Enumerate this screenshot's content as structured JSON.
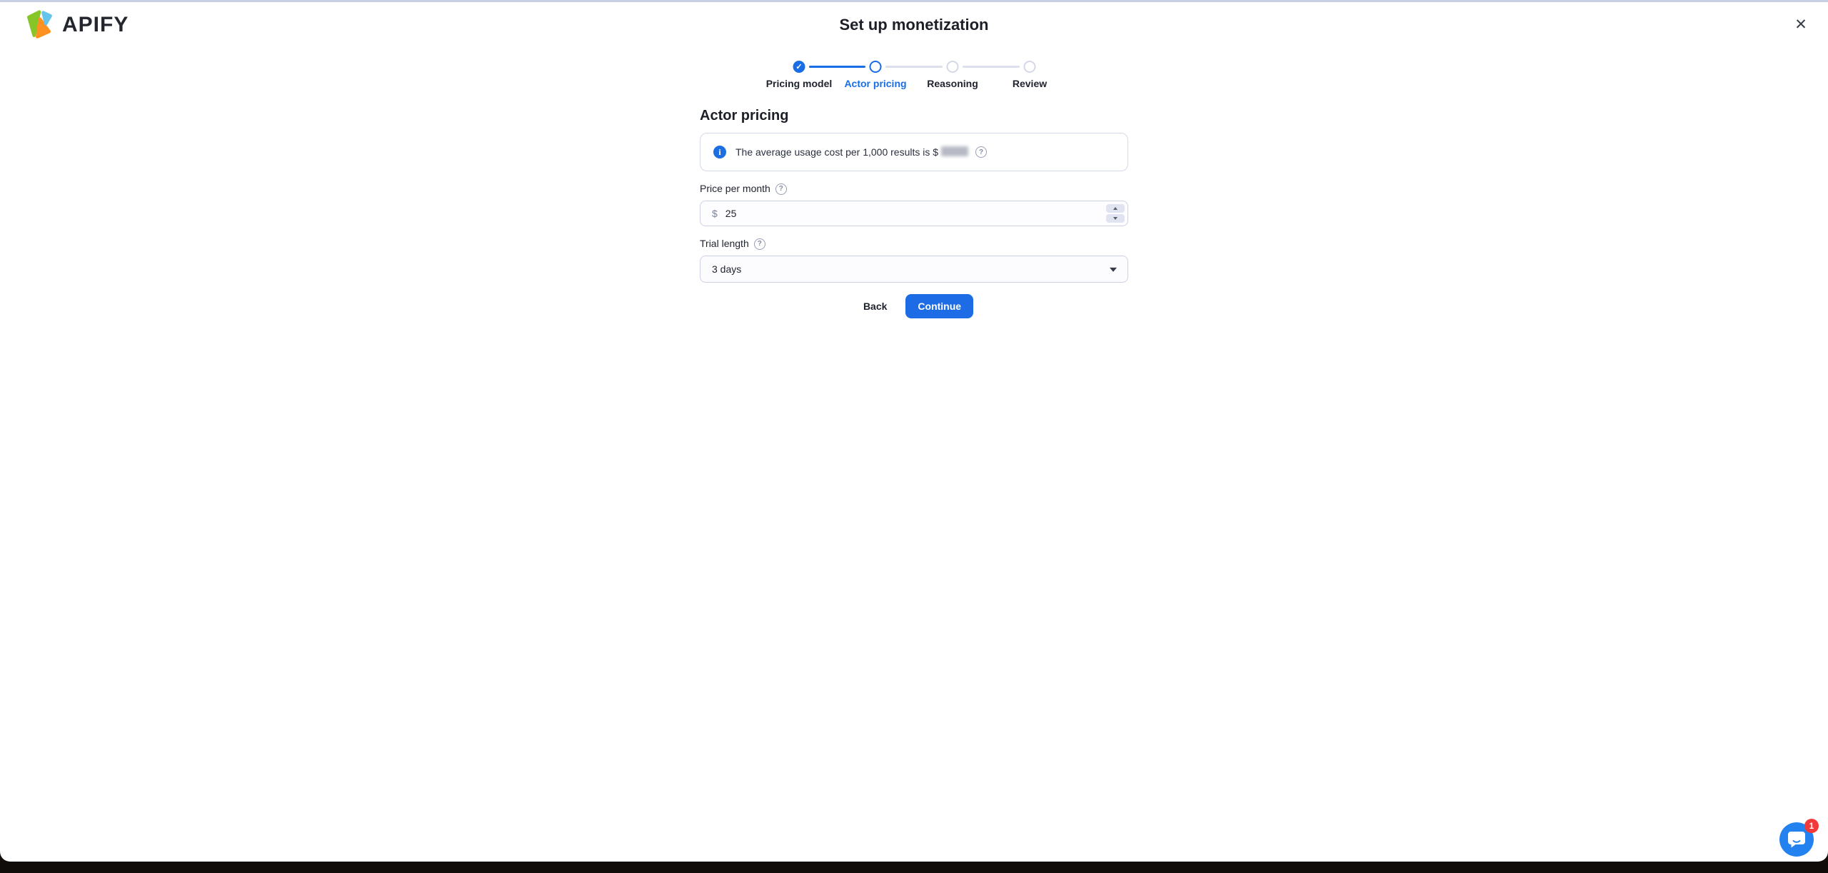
{
  "header": {
    "brand": "APIFY",
    "title": "Set up monetization",
    "close_icon": "✕"
  },
  "stepper": {
    "steps": [
      {
        "label": "Pricing model",
        "state": "complete"
      },
      {
        "label": "Actor pricing",
        "state": "active"
      },
      {
        "label": "Reasoning",
        "state": "upcoming"
      },
      {
        "label": "Review",
        "state": "upcoming"
      }
    ],
    "check_icon": "✓"
  },
  "form": {
    "heading": "Actor pricing",
    "info_banner": {
      "info_icon": "i",
      "text": "The average usage cost per 1,000 results is $",
      "redacted_value": "",
      "help_icon": "?"
    },
    "price_field": {
      "label": "Price per month",
      "help_icon": "?",
      "currency_prefix": "$",
      "value": "25"
    },
    "trial_field": {
      "label": "Trial length",
      "help_icon": "?",
      "selected_option": "3 days"
    },
    "actions": {
      "back_label": "Back",
      "continue_label": "Continue"
    }
  },
  "chat_widget": {
    "unread_count": "1"
  },
  "colors": {
    "accent_blue": "#1a6ee5",
    "button_blue": "#1e6be6",
    "chat_blue": "#2382f0",
    "badge_red": "#f23a3a",
    "border_gray": "#ccd2e4",
    "connector_gray": "#dcdfec",
    "logo_green": "#86c626",
    "logo_orange": "#fd9222",
    "logo_sky_blue": "#66c4ea",
    "top_edge": "#c8cfe2"
  }
}
